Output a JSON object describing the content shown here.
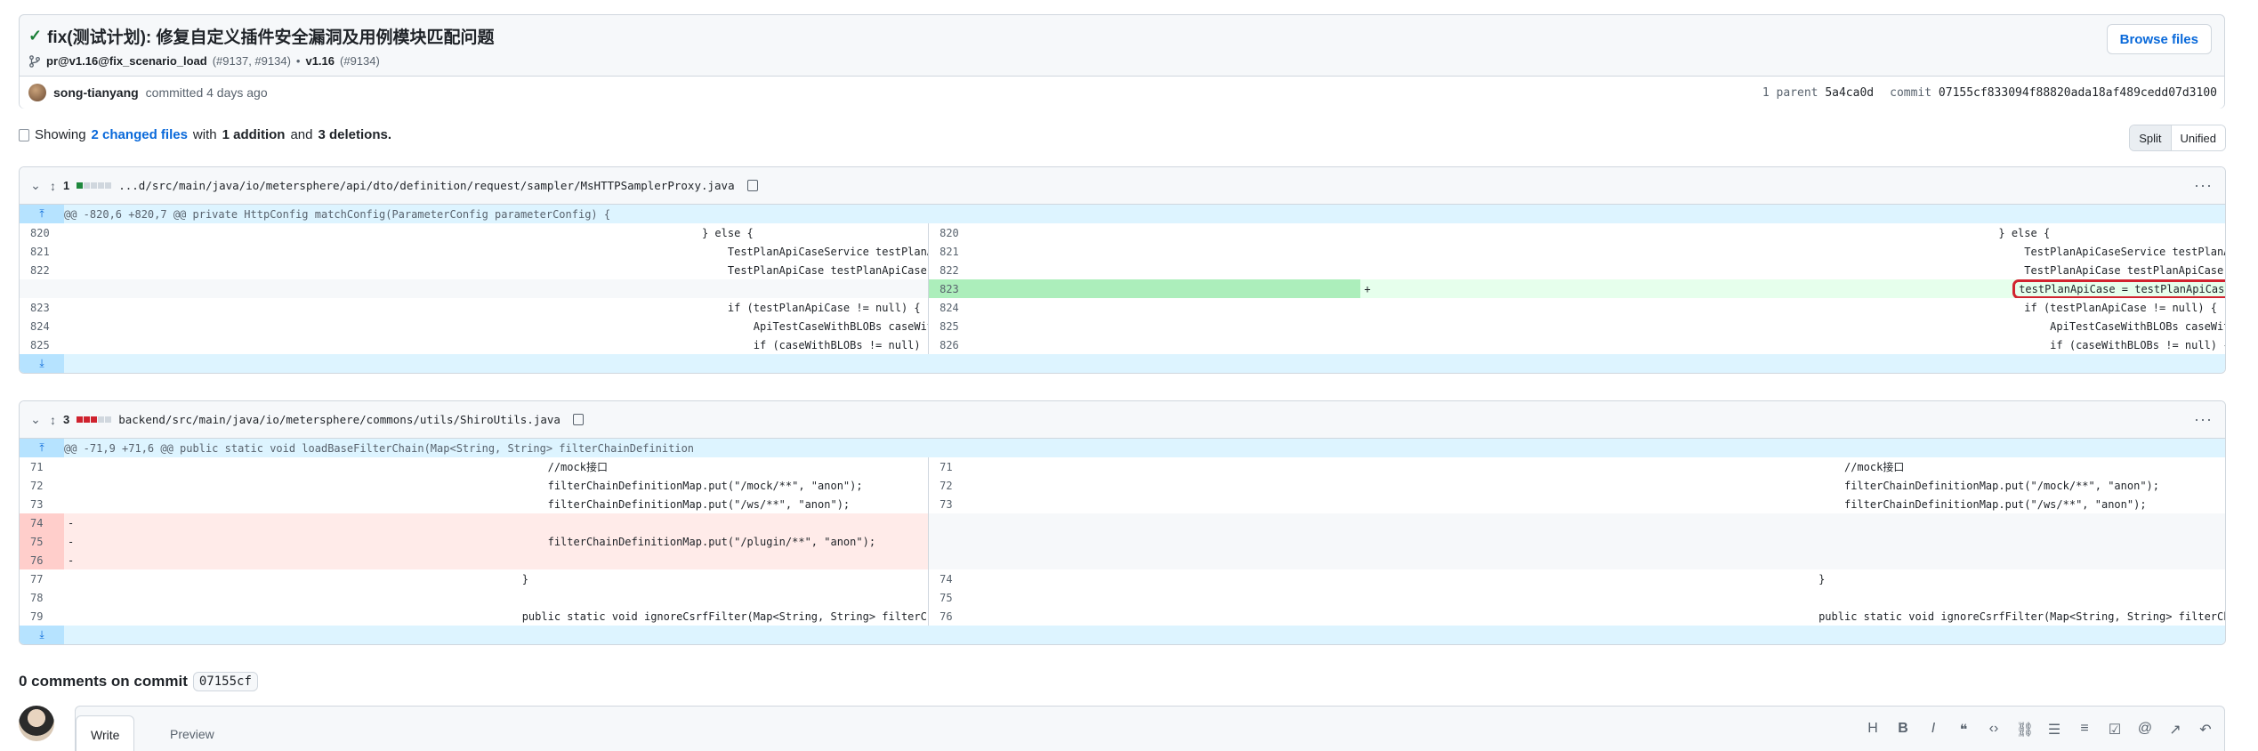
{
  "commit": {
    "title": "fix(测试计划): 修复自定义插件安全漏洞及用例模块匹配问题",
    "branch": "pr@v1.16@fix_scenario_load",
    "branch_refs": "(#9137, #9134)",
    "tag": "v1.16",
    "tag_ref": "(#9134)",
    "browse_label": "Browse files",
    "author": "song-tianyang",
    "committed_text": "committed 4 days ago",
    "parent_label": "1 parent",
    "parent_sha": "5a4ca0d",
    "commit_label": "commit",
    "commit_sha": "07155cf833094f88820ada18af489cedd07d3100"
  },
  "summary": {
    "prefix": "Showing",
    "changed_files": "2 changed files",
    "with": "with",
    "additions": "1 addition",
    "and": "and",
    "deletions": "3 deletions."
  },
  "view_toggle": {
    "split": "Split",
    "unified": "Unified"
  },
  "files": [
    {
      "count": "1",
      "path": "...d/src/main/java/io/metersphere/api/dto/definition/request/sampler/MsHTTPSamplerProxy.java",
      "hunk": "@@ -820,6 +820,7 @@ private HttpConfig matchConfig(ParameterConfig parameterConfig) {",
      "rows": [
        {
          "l": "820",
          "lc": "                                } else {",
          "r": "820",
          "rc": "                                } else {"
        },
        {
          "l": "821",
          "lc": "                                    TestPlanApiCaseService testPlanApiCaseService = CommonBeanFactory.getBean(TestPlanApiCaseService.class);",
          "r": "821",
          "rc": "                                    TestPlanApiCaseService testPlanApiCaseService = CommonBeanFactory.getBean(TestPlanApiCaseService.class);"
        },
        {
          "l": "822",
          "lc": "                                    TestPlanApiCase testPlanApiCase = testPlanApiCaseService.getById(this.getId());",
          "r": "822",
          "rc": "                                    TestPlanApiCase testPlanApiCase = testPlanApiCaseService.getById(this.getId());"
        },
        {
          "l": "",
          "lc": "",
          "r": "823",
          "rc": "testPlanApiCase = testPlanApiCase == null ? testPlanApiCaseService.getById(this.getName()) : testPlanApiCase;",
          "mark": "+"
        },
        {
          "l": "823",
          "lc": "                                    if (testPlanApiCase != null) {",
          "r": "824",
          "rc": "                                    if (testPlanApiCase != null) {"
        },
        {
          "l": "824",
          "lc": "                                        ApiTestCaseWithBLOBs caseWithBLOBs = apiTestCaseService.get(testPlanApiCase.getApiCaseId());",
          "r": "825",
          "rc": "                                        ApiTestCaseWithBLOBs caseWithBLOBs = apiTestCaseService.get(testPlanApiCase.getApiCaseId());"
        },
        {
          "l": "825",
          "lc": "                                        if (caseWithBLOBs != null) {",
          "r": "826",
          "rc": "                                        if (caseWithBLOBs != null) {"
        }
      ]
    },
    {
      "count": "3",
      "path": "backend/src/main/java/io/metersphere/commons/utils/ShiroUtils.java",
      "hunk": "@@ -71,9 +71,6 @@ public static void loadBaseFilterChain(Map<String, String> filterChainDefinition",
      "rows": [
        {
          "l": "71",
          "lc": "        //mock接口",
          "r": "71",
          "rc": "        //mock接口"
        },
        {
          "l": "72",
          "lc": "        filterChainDefinitionMap.put(\"/mock/**\", \"anon\");",
          "r": "72",
          "rc": "        filterChainDefinitionMap.put(\"/mock/**\", \"anon\");"
        },
        {
          "l": "73",
          "lc": "        filterChainDefinitionMap.put(\"/ws/**\", \"anon\");",
          "r": "73",
          "rc": "        filterChainDefinitionMap.put(\"/ws/**\", \"anon\");"
        },
        {
          "l": "74",
          "lc": "",
          "r": "",
          "rc": "",
          "mark": "-"
        },
        {
          "l": "75",
          "lc": "        filterChainDefinitionMap.put(\"/plugin/**\", \"anon\");",
          "r": "",
          "rc": "",
          "mark": "-"
        },
        {
          "l": "76",
          "lc": "",
          "r": "",
          "rc": "",
          "mark": "-"
        },
        {
          "l": "77",
          "lc": "    }",
          "r": "74",
          "rc": "    }"
        },
        {
          "l": "78",
          "lc": "",
          "r": "75",
          "rc": ""
        },
        {
          "l": "79",
          "lc": "    public static void ignoreCsrfFilter(Map<String, String> filterChainDefinitionMap) {",
          "r": "76",
          "rc": "    public static void ignoreCsrfFilter(Map<String, String> filterChainDefinitionMap) {"
        }
      ]
    }
  ],
  "comments": {
    "heading": "0 comments on commit",
    "sha": "07155cf",
    "tab_write": "Write",
    "tab_preview": "Preview"
  },
  "toolbar_icons": [
    "heading-icon",
    "bold-icon",
    "italic-icon",
    "quote-icon",
    "code-icon",
    "link-icon",
    "unordered-list-icon",
    "ordered-list-icon",
    "task-list-icon",
    "mention-icon",
    "reference-icon",
    "undo-icon"
  ]
}
